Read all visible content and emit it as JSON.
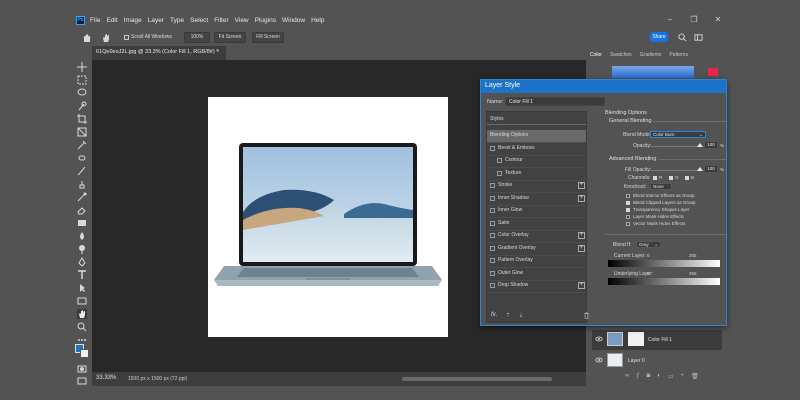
{
  "menu": {
    "logo": "Ps",
    "items": [
      "File",
      "Edit",
      "Image",
      "Layer",
      "Type",
      "Select",
      "Filter",
      "View",
      "Plugins",
      "Window",
      "Help"
    ]
  },
  "options_bar": {
    "scroll_all": "Scroll All Windows",
    "zoom": "100%",
    "fit_screen": "Fit Screen",
    "fill_screen": "Fill Screen",
    "share": "Share"
  },
  "document": {
    "tab_title": "61Qe0eoJ2L.jpg @ 33.3% (Color Fill 1, RGB/8#) *",
    "tab_close": "×",
    "zoom": "33.33%",
    "size": "1500 px x 1500 px (72 ppi)"
  },
  "dock": {
    "tabs": [
      "Color",
      "Swatches",
      "Gradients",
      "Patterns"
    ],
    "layers": [
      {
        "name": "Color Fill 1"
      },
      {
        "name": "Layer 0"
      }
    ]
  },
  "dialog": {
    "title": "Layer Style",
    "name_label": "Name:",
    "name_value": "Color Fill 1",
    "styles_header": "Styles",
    "styles": [
      {
        "label": "Blending Options",
        "checkbox": false,
        "plus": false,
        "active": true
      },
      {
        "label": "Bevel & Emboss",
        "checkbox": true,
        "plus": false
      },
      {
        "label": "Contour",
        "checkbox": true,
        "plus": false,
        "indent": true
      },
      {
        "label": "Texture",
        "checkbox": true,
        "plus": false,
        "indent": true
      },
      {
        "label": "Stroke",
        "checkbox": true,
        "plus": true
      },
      {
        "label": "Inner Shadow",
        "checkbox": true,
        "plus": true
      },
      {
        "label": "Inner Glow",
        "checkbox": true,
        "plus": false
      },
      {
        "label": "Satin",
        "checkbox": true,
        "plus": false
      },
      {
        "label": "Color Overlay",
        "checkbox": true,
        "plus": true
      },
      {
        "label": "Gradient Overlay",
        "checkbox": true,
        "plus": true
      },
      {
        "label": "Pattern Overlay",
        "checkbox": true,
        "plus": false
      },
      {
        "label": "Outer Glow",
        "checkbox": true,
        "plus": false
      },
      {
        "label": "Drop Shadow",
        "checkbox": true,
        "plus": true
      }
    ],
    "fx": "fx.",
    "options": {
      "title": "Blending Options",
      "general": "General Blending",
      "blend_mode_label": "Blend Mode:",
      "blend_mode": "Color Burn",
      "opacity_label": "Opacity:",
      "opacity": "100",
      "opacity_level": 1.0,
      "advanced": "Advanced Blending",
      "fill_opacity_label": "Fill Opacity:",
      "fill_opacity": "100",
      "fill_level": 1.0,
      "channels_label": "Channels:",
      "channels": [
        "R",
        "G",
        "B"
      ],
      "knockout_label": "Knockout:",
      "knockout": "None",
      "checks": [
        {
          "label": "Blend Interior Effects as Group",
          "on": false
        },
        {
          "label": "Blend Clipped Layers as Group",
          "on": true
        },
        {
          "label": "Transparency Shapes Layer",
          "on": true
        },
        {
          "label": "Layer Mask Hides Effects",
          "on": false
        },
        {
          "label": "Vector Mask Hides Effects",
          "on": false
        }
      ],
      "blend_if_label": "Blend If:",
      "blend_if": "Gray",
      "current_layer": "Current Layer:",
      "underlying_layer": "Underlying Layer:",
      "tick_low": "0",
      "tick_high": "255",
      "pct": "%"
    }
  }
}
